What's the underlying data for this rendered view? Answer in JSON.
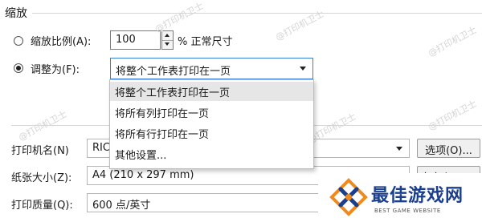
{
  "scaling": {
    "section_title": "缩放",
    "option_percent_label": "缩放比例(A):",
    "percent_value": "100",
    "percent_suffix": "% 正常尺寸",
    "option_fit_label": "调整为(F):",
    "fit_selected": "将整个工作表打印在一页",
    "fit_options": [
      "将整个工作表打印在一页",
      "将所有列打印在一页",
      "将所有行打印在一页",
      "其他设置..."
    ]
  },
  "printer": {
    "printer_name_label": "打印机名(N)",
    "printer_name_value": "RIC",
    "options_button": "选项(O)...",
    "paper_size_label": "纸张大小(Z):",
    "paper_size_value": "A4 (210 x 297 mm)",
    "custom_button": "自定义(C)...",
    "quality_label": "打印质量(Q):",
    "quality_value": "600 点/英寸"
  },
  "watermark": {
    "text": "@打印机卫士",
    "logo_title": "最佳游戏网",
    "logo_subtitle": "BEST GAME WEBSITE"
  }
}
